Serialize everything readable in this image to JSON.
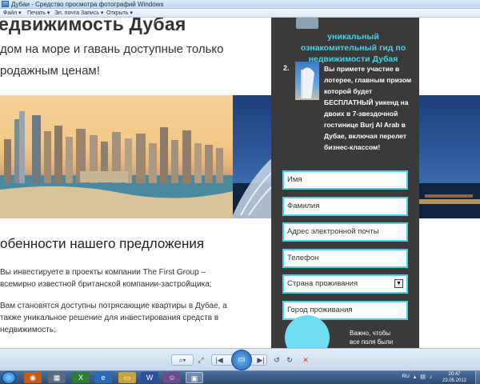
{
  "window": {
    "title": "Дубаи - Средство просмотра фотографий Windows",
    "menu": [
      "Файл ▾",
      "Печать ▾",
      "Эл. почта",
      "Запись ▾",
      "Открыть ▾"
    ]
  },
  "page": {
    "heading": "едвижимость Дубая",
    "subtitle_line1": "дом на море и гавань доступные только",
    "subtitle_line2": "родажным ценам!",
    "section_title": "обенности нашего предложения",
    "para1": "Вы инвестируете в проекты компании The First Group – всемирно известной британской компании-застройщика;",
    "para2": "Вам становятся доступны потрясающие квартиры в Дубае, а также уникальное решение для инвестирования средств в недвижимость;"
  },
  "sidebar": {
    "heading": "уникальный ознакомительный гид по недвижимости Дубая",
    "item_number": "2.",
    "item_text": "Вы примете участие в лотерее, главным призом которой будет БЕСПЛАТНЫЙ уикенд на двоих в 7-звездочной гостинице Burj Al Arab в Дубае, включая перелет бизнес-классом!",
    "fields": {
      "name": "Имя",
      "surname": "Фамилия",
      "email": "Адрес электронной почты",
      "phone": "Телефон",
      "country": "Страна проживания",
      "city": "Город проживания"
    },
    "note": "Важно, чтобы все поля были"
  },
  "taskbar": {
    "language": "RU",
    "time": "20:47",
    "date": "23.05.2012"
  },
  "colors": {
    "accent": "#4ad2e8",
    "sidebar_bg": "#3a3a3a",
    "taskbar_bg": "#2c4a75"
  }
}
